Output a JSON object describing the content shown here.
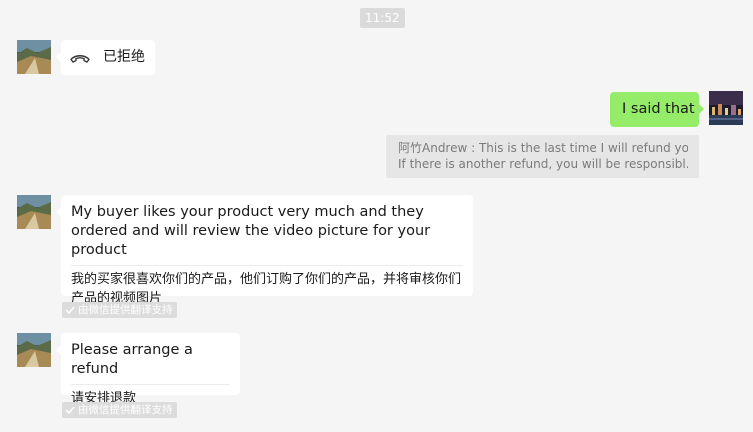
{
  "timestamp": "11:52",
  "call_message": {
    "status_text": "已拒绝",
    "icon": "phone-hangup-icon"
  },
  "outgoing_message": {
    "text": "I said that"
  },
  "quoted_message": {
    "line1": "阿竹Andrew : This is the last time I will refund you.",
    "line2": "If there is another refund, you will be responsibl..."
  },
  "messages": [
    {
      "original": "My buyer likes your product very much and they ordered and will review the video picture for your product",
      "translation": "我的买家很喜欢你们的产品，他们订购了你们的产品，并将审核你们产品的视频图片",
      "tag": "由微信提供翻译支持"
    },
    {
      "original": "Please arrange a refund",
      "translation": "请安排退款",
      "tag": "由微信提供翻译支持"
    }
  ],
  "colors": {
    "outgoing_bubble": "#95ec69",
    "incoming_bubble": "#ffffff",
    "background": "#f5f5f5"
  }
}
